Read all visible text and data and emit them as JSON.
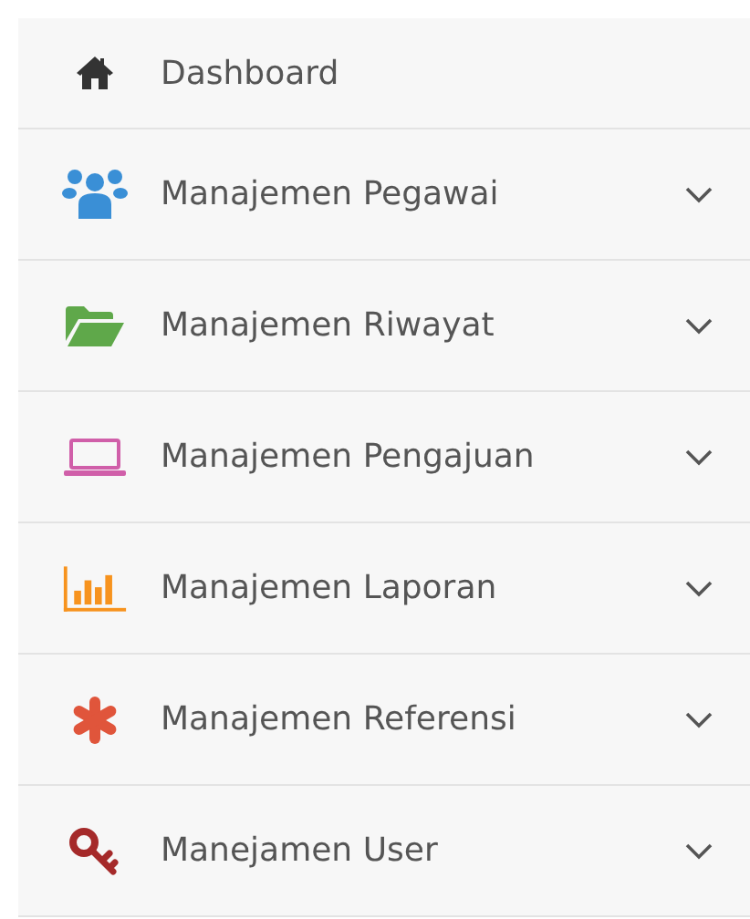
{
  "menu": [
    {
      "label": "Dashboard",
      "kind": "home",
      "expandable": false
    },
    {
      "label": "Manajemen Pegawai",
      "kind": "users",
      "expandable": true
    },
    {
      "label": "Manajemen Riwayat",
      "kind": "folder",
      "expandable": true
    },
    {
      "label": "Manajemen Pengajuan",
      "kind": "laptop",
      "expandable": true
    },
    {
      "label": "Manajemen Laporan",
      "kind": "chart",
      "expandable": true
    },
    {
      "label": "Manajemen Referensi",
      "kind": "asterisk",
      "expandable": true
    },
    {
      "label": "Manejamen User",
      "kind": "key",
      "expandable": true
    }
  ]
}
